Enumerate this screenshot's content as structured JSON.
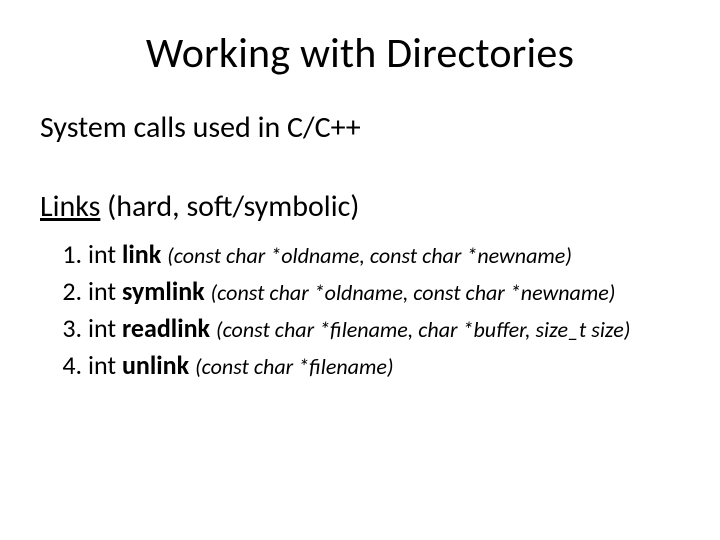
{
  "title": "Working with Directories",
  "subtitle": "System calls used in C/C++",
  "section_underlined": "Links",
  "section_rest": " (hard, soft/symbolic)",
  "items": [
    {
      "ret": "int ",
      "fn": "link ",
      "args": "(const char *oldname, const char *newname)"
    },
    {
      "ret": "int ",
      "fn": "symlink ",
      "args": "(const char *oldname, const char *newname)"
    },
    {
      "ret": "int ",
      "fn": "readlink ",
      "args": "(const char *filename, char *buffer, size_t size)"
    },
    {
      "ret": "int ",
      "fn": "unlink ",
      "args": "(const char *filename)"
    }
  ]
}
